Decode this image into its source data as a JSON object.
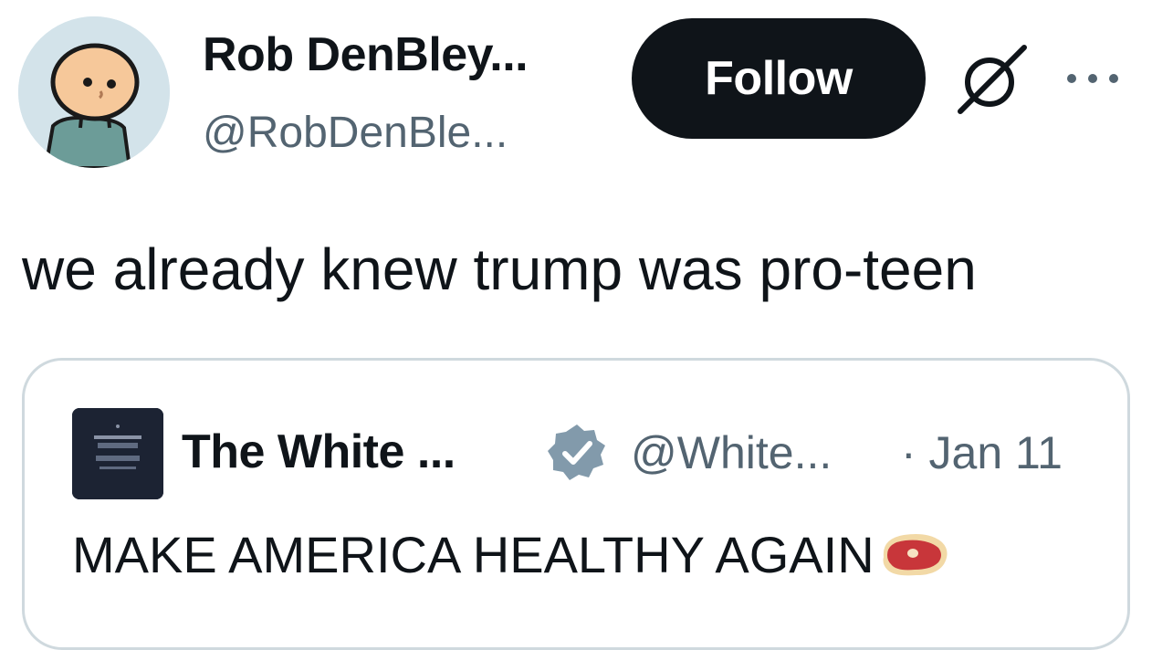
{
  "author": {
    "display_name": "Rob DenBley...",
    "handle": "@RobDenBle...",
    "avatar_icon": "cartoon-person-avatar"
  },
  "actions": {
    "follow_label": "Follow",
    "grok_icon": "grok-icon",
    "more_icon": "more-icon"
  },
  "tweet": {
    "text": "we already knew trump was pro-teen"
  },
  "quoted_tweet": {
    "display_name": "The White ...",
    "verified": true,
    "verified_color": "#829aab",
    "handle": "@White...",
    "date": "· Jan 11",
    "text": "MAKE AMERICA HEALTHY AGAIN",
    "emoji_icon": "steak-icon",
    "avatar_icon": "white-house-logo"
  },
  "colors": {
    "text_primary": "#0f1419",
    "text_secondary": "#536471",
    "follow_bg": "#0f1419",
    "card_border": "#cfd9de"
  }
}
